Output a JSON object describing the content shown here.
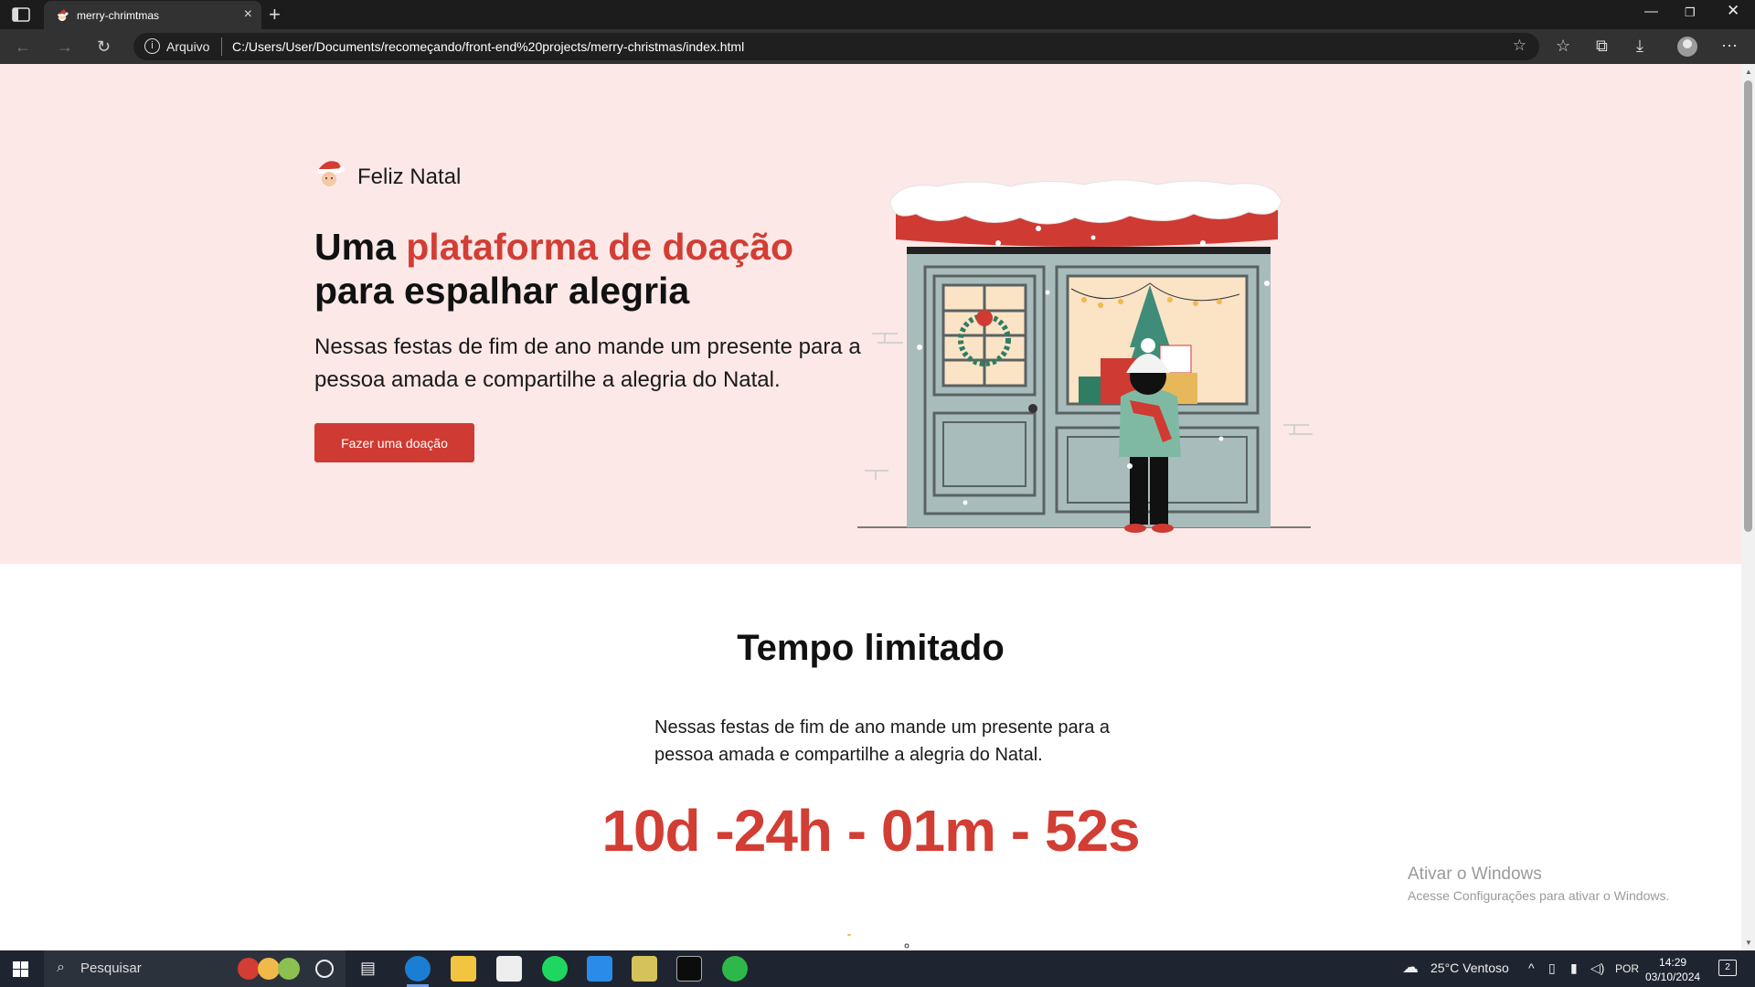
{
  "browser": {
    "tab_title": "merry-chrimtmas",
    "new_tab": "+",
    "scheme_label": "Arquivo",
    "url": "C:/Users/User/Documents/recomeçando/front-end%20projects/merry-christmas/index.html",
    "icons": [
      "tab-actions-icon",
      "back-icon",
      "forward-icon",
      "refresh-icon",
      "info-icon",
      "add-favorite-icon",
      "favorites-icon",
      "collections-icon",
      "downloads-icon",
      "profile-icon",
      "more-icon",
      "minimize-icon",
      "restore-icon",
      "close-icon"
    ]
  },
  "hero": {
    "brand": "Feliz Natal",
    "headline_part1": "Uma ",
    "headline_accent": "plataforma de doação",
    "headline_part2": "para espalhar alegria",
    "lead": "Nessas festas de fim de ano mande um presente para a pessoa amada e compartilhe a alegria do Natal.",
    "cta": "Fazer uma doação",
    "colors": {
      "background": "#fde8e8",
      "accent": "#d23d34",
      "button": "#cf3a32"
    }
  },
  "section": {
    "title": "Tempo limitado",
    "text": "Nessas festas de fim de ano mande um presente para a pessoa amada e compartilhe a alegria do Natal.",
    "countdown": "10d -24h - 01m - 52s"
  },
  "watermark": {
    "line1": "Ativar o Windows",
    "line2": "Acesse Configurações para ativar o Windows."
  },
  "taskbar": {
    "search_placeholder": "Pesquisar",
    "weather": "25°C  Ventoso",
    "language": "POR",
    "time": "14:29",
    "date": "03/10/2024",
    "notifications": "2"
  }
}
